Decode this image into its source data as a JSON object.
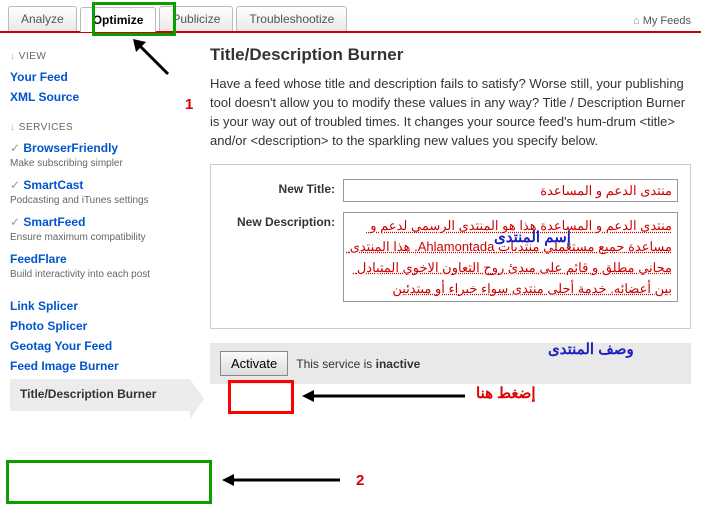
{
  "tabs": {
    "analyze": "Analyze",
    "optimize": "Optimize",
    "publicize": "Publicize",
    "troubleshoot": "Troubleshootize"
  },
  "myfeeds": "My Feeds",
  "sidebar": {
    "view_hdr": "VIEW",
    "your_feed": "Your Feed",
    "xml_source": "XML Source",
    "svc_hdr": "SERVICES",
    "bf": {
      "t": "BrowserFriendly",
      "s": "Make subscribing simpler"
    },
    "sc": {
      "t": "SmartCast",
      "s": "Podcasting and iTunes settings"
    },
    "sf": {
      "t": "SmartFeed",
      "s": "Ensure maximum compatibility"
    },
    "ff": {
      "t": "FeedFlare",
      "s": "Build interactivity into each post"
    },
    "ls": "Link Splicer",
    "ps": "Photo Splicer",
    "gt": "Geotag Your Feed",
    "fib": "Feed Image Burner",
    "tdb": "Title/Description Burner"
  },
  "main": {
    "title": "Title/Description Burner",
    "desc": "Have a feed whose title and description fails to satisfy? Worse still, your publishing tool doesn't allow you to modify these values in any way? Title / Description Burner is your way out of troubled times. It changes your source feed's hum-drum <title> and/or <description> to the sparkling new values you specify below.",
    "new_title_lbl": "New Title:",
    "new_title_val": "منتدى الدعم و المساعدة",
    "new_desc_lbl": "New Description:",
    "new_desc_val": "منتدى الدعم و المساعدة هذا هو المنتدى الرسمي لدعم و مساعدة جميع مستعملي منتديات Ahlamontada. هذا المنتدى مجاني مطلق و قائم على مبدئ روح التعاون الاخوي المتبادل بين أعضائه. خدمة أحلى منتدى سواء خبراء أو مبتدئين",
    "activate": "Activate",
    "status_pre": "This service is ",
    "status_val": "inactive"
  },
  "ann": {
    "one": "1",
    "two": "2",
    "name": "إسم المنتدى",
    "desc": "وصف المنتدى",
    "press": "إضغط هنا"
  }
}
